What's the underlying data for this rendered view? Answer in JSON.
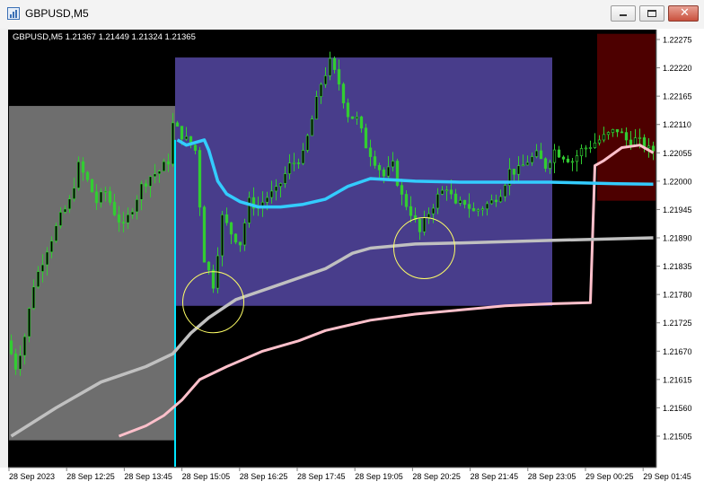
{
  "window": {
    "title": "GBPUSD,M5",
    "close_glyph": "✕",
    "icons": {
      "app": "chart-app-icon",
      "minimize": "minimize-icon",
      "maximize": "maximize-icon",
      "close": "close-icon"
    }
  },
  "chart": {
    "info_line": "GBPUSD,M5  1.21367 1.21449 1.21324 1.21365",
    "colors": {
      "background": "#000000",
      "candles": "#32cd32",
      "gray_zone": "#6e6e6e",
      "purple_zone": "#483d8b",
      "red_zone": "#4d0000",
      "aqua_ma": "#33ccff",
      "silver_ma": "#c0c0c0",
      "pink_ma": "#ffc0cb",
      "cyan_line": "#00e5ff",
      "circles": "#ffff66"
    }
  },
  "chart_data": {
    "type": "candlestick",
    "symbol": "GBPUSD",
    "timeframe": "M5",
    "ohlc_last": {
      "open": 1.21367,
      "high": 1.21449,
      "low": 1.21324,
      "close": 1.21365
    },
    "y_ticks": [
      "1.22275",
      "1.22220",
      "1.22165",
      "1.22110",
      "1.22055",
      "1.22000",
      "1.21945",
      "1.21890",
      "1.21835",
      "1.21780",
      "1.21725",
      "1.21670",
      "1.21615",
      "1.21560",
      "1.21505"
    ],
    "x_ticks": [
      "28 Sep 2023",
      "28 Sep 12:25",
      "28 Sep 13:45",
      "28 Sep 15:05",
      "28 Sep 16:25",
      "28 Sep 17:45",
      "28 Sep 19:05",
      "28 Sep 20:25",
      "28 Sep 21:45",
      "28 Sep 23:05",
      "29 Sep 00:25",
      "29 Sep 01:45"
    ],
    "ylim": [
      1.21495,
      1.22295
    ],
    "bar_count": 144,
    "zones": [
      {
        "name": "gray-zone",
        "from_bar": 0,
        "to_bar": 36,
        "top": 1.22146,
        "bottom": 1.21497
      },
      {
        "name": "purple-zone",
        "from_bar": 37,
        "to_bar": 120,
        "top": 1.2224,
        "bottom": 1.21758
      },
      {
        "name": "red-zone",
        "from_bar": 131,
        "to_bar": 143,
        "top": 1.22286,
        "bottom": 1.21962
      }
    ],
    "circles": [
      {
        "name": "low-circle-left",
        "bar": 45,
        "price": 1.21765
      },
      {
        "name": "low-circle-mid",
        "bar": 92,
        "price": 1.2187
      }
    ],
    "aqua_ma": [
      [
        37,
        1.2208
      ],
      [
        39,
        1.2207
      ],
      [
        41,
        1.22075
      ],
      [
        43,
        1.2208
      ],
      [
        44,
        1.2206
      ],
      [
        46,
        1.22
      ],
      [
        48,
        1.21975
      ],
      [
        51,
        1.2196
      ],
      [
        55,
        1.2195
      ],
      [
        60,
        1.2195
      ],
      [
        65,
        1.21955
      ],
      [
        70,
        1.21965
      ],
      [
        75,
        1.2199
      ],
      [
        80,
        1.22005
      ],
      [
        90,
        1.22
      ],
      [
        100,
        1.21998
      ],
      [
        120,
        1.21998
      ],
      [
        135,
        1.21995
      ],
      [
        143,
        1.21994
      ]
    ],
    "silver_ma": [
      [
        0,
        1.21505
      ],
      [
        10,
        1.2156
      ],
      [
        20,
        1.2161
      ],
      [
        30,
        1.2164
      ],
      [
        36,
        1.21665
      ],
      [
        40,
        1.21705
      ],
      [
        44,
        1.21735
      ],
      [
        50,
        1.2177
      ],
      [
        60,
        1.218
      ],
      [
        70,
        1.2183
      ],
      [
        76,
        1.2186
      ],
      [
        80,
        1.2187
      ],
      [
        90,
        1.21878
      ],
      [
        100,
        1.2188
      ],
      [
        120,
        1.21885
      ],
      [
        143,
        1.2189
      ]
    ],
    "pink_ma": [
      [
        24,
        1.21505
      ],
      [
        30,
        1.21525
      ],
      [
        34,
        1.21545
      ],
      [
        38,
        1.21575
      ],
      [
        42,
        1.21615
      ],
      [
        48,
        1.2164
      ],
      [
        56,
        1.2167
      ],
      [
        64,
        1.2169
      ],
      [
        70,
        1.2171
      ],
      [
        80,
        1.2173
      ],
      [
        90,
        1.21742
      ],
      [
        100,
        1.2175
      ],
      [
        110,
        1.21758
      ],
      [
        120,
        1.21762
      ],
      [
        129,
        1.21764
      ],
      [
        130,
        1.2203
      ],
      [
        132,
        1.2204
      ],
      [
        136,
        1.22065
      ],
      [
        140,
        1.2207
      ],
      [
        143,
        1.22055
      ]
    ],
    "cyan_vertical_bar": 37
  }
}
